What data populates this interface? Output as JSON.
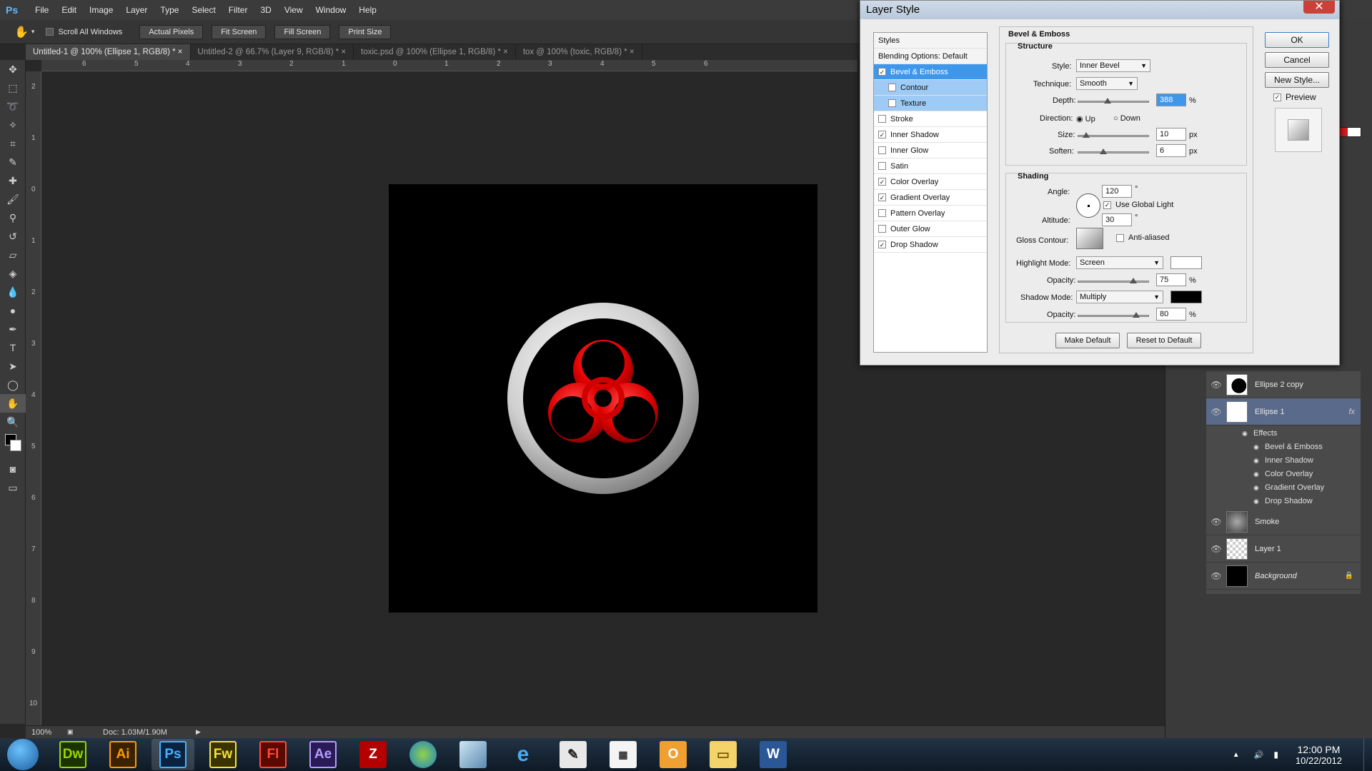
{
  "app": {
    "logo": "Ps"
  },
  "menu": [
    "File",
    "Edit",
    "Image",
    "Layer",
    "Type",
    "Select",
    "Filter",
    "3D",
    "View",
    "Window",
    "Help"
  ],
  "options": {
    "scroll_all": "Scroll All Windows",
    "buttons": [
      "Actual Pixels",
      "Fit Screen",
      "Fill Screen",
      "Print Size"
    ]
  },
  "tabs": [
    "Untitled-1 @ 100% (Ellipse 1, RGB/8) *",
    "Untitled-2 @ 66.7% (Layer 9, RGB/8) *",
    "toxic.psd @ 100% (Ellipse 1, RGB/8) *",
    "tox @ 100% (toxic, RGB/8) *"
  ],
  "status": {
    "zoom": "100%",
    "doc": "Doc: 1.03M/1.90M"
  },
  "dialog": {
    "title": "Layer Style",
    "styles_header": "Styles",
    "blending": "Blending Options: Default",
    "styles": [
      {
        "label": "Bevel & Emboss",
        "checked": true
      },
      {
        "label": "Contour",
        "checked": false
      },
      {
        "label": "Texture",
        "checked": false
      },
      {
        "label": "Stroke",
        "checked": false
      },
      {
        "label": "Inner Shadow",
        "checked": true
      },
      {
        "label": "Inner Glow",
        "checked": false
      },
      {
        "label": "Satin",
        "checked": false
      },
      {
        "label": "Color Overlay",
        "checked": true
      },
      {
        "label": "Gradient Overlay",
        "checked": true
      },
      {
        "label": "Pattern Overlay",
        "checked": false
      },
      {
        "label": "Outer Glow",
        "checked": false
      },
      {
        "label": "Drop Shadow",
        "checked": true
      }
    ],
    "section": "Bevel & Emboss",
    "structure": "Structure",
    "style_label": "Style:",
    "style_value": "Inner Bevel",
    "technique_label": "Technique:",
    "technique_value": "Smooth",
    "depth_label": "Depth:",
    "depth_value": "388",
    "pct": "%",
    "direction_label": "Direction:",
    "dir_up": "Up",
    "dir_down": "Down",
    "size_label": "Size:",
    "size_value": "10",
    "px": "px",
    "soften_label": "Soften:",
    "soften_value": "6",
    "shading": "Shading",
    "angle_label": "Angle:",
    "angle_value": "120",
    "deg": "°",
    "global_light": "Use Global Light",
    "altitude_label": "Altitude:",
    "altitude_value": "30",
    "gloss_label": "Gloss Contour:",
    "anti_aliased": "Anti-aliased",
    "highlight_label": "Highlight Mode:",
    "highlight_value": "Screen",
    "opacity_label": "Opacity:",
    "highlight_opacity": "75",
    "shadow_label": "Shadow Mode:",
    "shadow_value": "Multiply",
    "shadow_opacity": "80",
    "make_default": "Make Default",
    "reset_default": "Reset to Default",
    "ok": "OK",
    "cancel": "Cancel",
    "new_style": "New Style...",
    "preview": "Preview"
  },
  "layers": [
    {
      "name": "Ellipse 2 copy"
    },
    {
      "name": "Ellipse 1",
      "fx": "fx"
    },
    {
      "name": "Smoke"
    },
    {
      "name": "Layer 1"
    },
    {
      "name": "Background"
    }
  ],
  "effects_label": "Effects",
  "effects": [
    "Bevel & Emboss",
    "Inner Shadow",
    "Color Overlay",
    "Gradient Overlay",
    "Drop Shadow"
  ],
  "taskbar": {
    "apps": [
      {
        "label": "Dw",
        "color": "#9ad600",
        "bg": "#1a3300"
      },
      {
        "label": "Ai",
        "color": "#ff9a00",
        "bg": "#3a2200"
      },
      {
        "label": "Ps",
        "color": "#45b3ff",
        "bg": "#0a2340"
      },
      {
        "label": "Fw",
        "color": "#f4e23d",
        "bg": "#3a3300"
      },
      {
        "label": "Fl",
        "color": "#ff4a3a",
        "bg": "#5a0a00"
      },
      {
        "label": "Ae",
        "color": "#b49cff",
        "bg": "#2a1a55"
      }
    ],
    "time": "12:00 PM",
    "date": "10/22/2012"
  },
  "ruler_top": [
    "6",
    "5",
    "4",
    "3",
    "2",
    "1",
    "0",
    "1",
    "2",
    "3",
    "4",
    "5",
    "6"
  ],
  "ruler_left": [
    "2",
    "1",
    "0",
    "1",
    "2",
    "3",
    "4",
    "5",
    "6",
    "7",
    "8",
    "9",
    "10"
  ]
}
